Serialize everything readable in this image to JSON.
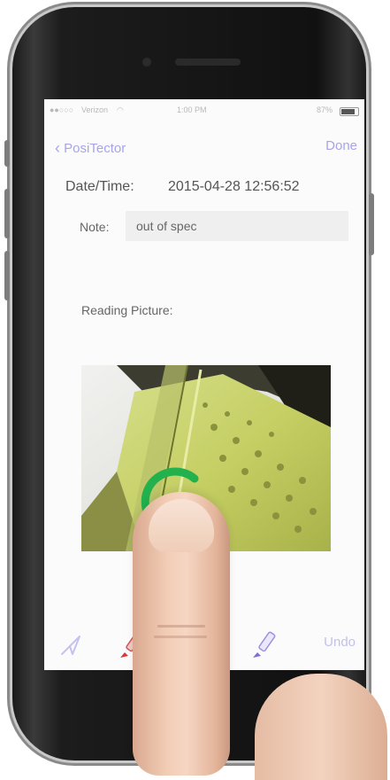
{
  "status_bar": {
    "carrier": "Verizon",
    "time": "1:00 PM",
    "battery": "87%"
  },
  "nav": {
    "back_label": "PosiTector",
    "done_label": "Done"
  },
  "reading": {
    "datetime_label": "Date/Time:",
    "datetime_value": "2015-04-28  12:56:52",
    "note_label": "Note:",
    "note_value": "out of spec",
    "picture_label": "Reading Picture:"
  },
  "toolbar": {
    "undo_label": "Undo",
    "tools": [
      "arrow-tool-icon",
      "red-marker-icon",
      "purple-marker-icon"
    ]
  },
  "colors": {
    "accent": "#a8a4e8",
    "annotation_circle": "#22b14c",
    "steel": "#c8d46e"
  }
}
